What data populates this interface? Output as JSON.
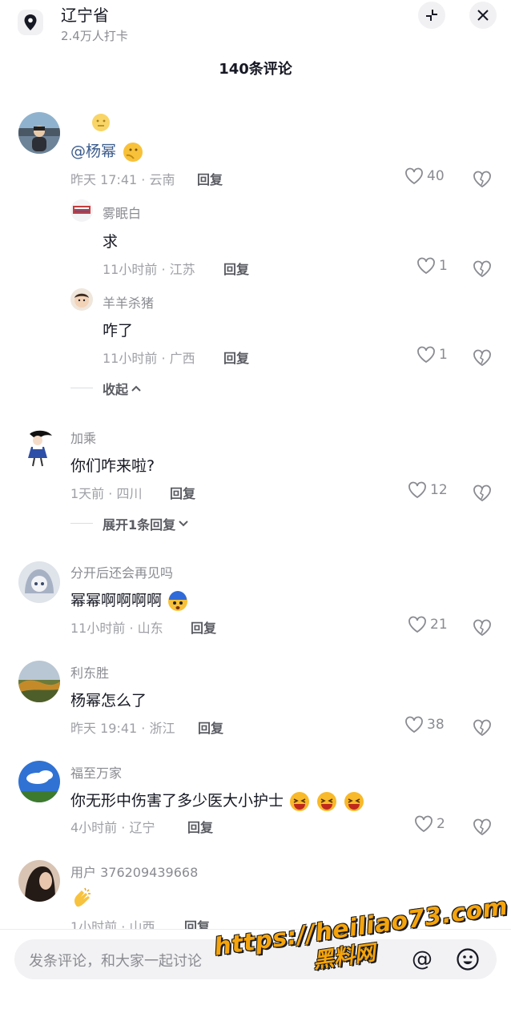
{
  "header": {
    "location_title": "辽宁省",
    "checkin_count": "2.4万人打卡",
    "comment_count_title": "140条评论"
  },
  "comments": [
    {
      "text_prefix": "",
      "text": "@杨幂",
      "time_region": "昨天 17:41 · 云南",
      "reply_label": "回复",
      "likes": "40",
      "replies": [
        {
          "name": "雾眠白",
          "text": "求",
          "time_region": "11小时前 · 江苏",
          "reply_label": "回复",
          "likes": "1"
        },
        {
          "name": "羊羊杀猪",
          "text": "咋了",
          "time_region": "11小时前 · 广西",
          "reply_label": "回复",
          "likes": "1"
        }
      ],
      "fold_label": "收起"
    },
    {
      "name": "加乘",
      "text": "你们咋来啦?",
      "time_region": "1天前 · 四川",
      "reply_label": "回复",
      "likes": "12",
      "expand_label": "展开1条回复"
    },
    {
      "name": "分开后还会再见吗",
      "text": "幂幂啊啊啊啊",
      "time_region": "11小时前 · 山东",
      "reply_label": "回复",
      "likes": "21"
    },
    {
      "name": "利东胜",
      "text": "杨幂怎么了",
      "time_region": "昨天 19:41 · 浙江",
      "reply_label": "回复",
      "likes": "38"
    },
    {
      "name": "福至万家",
      "text": "你无形中伤害了多少医大小护士",
      "time_region": "4小时前 · 辽宁",
      "reply_label": "回复",
      "likes": "2"
    },
    {
      "name": "用户 376209439668",
      "time_region": "1小时前 · 山西",
      "reply_label": "回复"
    }
  ],
  "composer": {
    "placeholder": "发条评论，和大家一起讨论",
    "at_label": "@"
  },
  "watermark": {
    "url": "https://heiliao73.com",
    "name": "黑料网"
  },
  "colors": {
    "text_primary": "#161823",
    "text_secondary": "#8a8b91",
    "watermark": "#f5a40c"
  }
}
